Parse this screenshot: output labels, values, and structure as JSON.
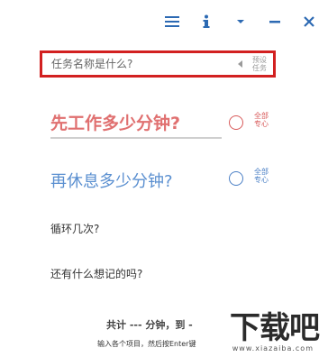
{
  "window_controls": {
    "menu_icon": "hamburger-menu-icon",
    "info_icon": "info-icon",
    "dropdown_icon": "caret-down-icon",
    "minimize_icon": "minimize-icon",
    "close_icon": "close-icon",
    "accent_color": "#2d6ab3"
  },
  "task": {
    "placeholder": "任务名称是什么?",
    "value": "",
    "preset_label": "预设任务",
    "highlight_color": "#d22020"
  },
  "work": {
    "question": "先工作多少分钟?",
    "radio_label": "全部专心",
    "color": "#e07070"
  },
  "rest": {
    "question": "再休息多少分钟?",
    "radio_label": "全部专心",
    "color": "#5a8fd0"
  },
  "loop": {
    "question": "循环几次?"
  },
  "notes": {
    "question": "还有什么想记的吗?"
  },
  "footer": {
    "summary": "共计 --- 分钟，到 -",
    "hint": "输入各个项目，然后按Enter键"
  },
  "watermark": {
    "text": "下载吧",
    "url": "www.xiazaiba.com"
  }
}
